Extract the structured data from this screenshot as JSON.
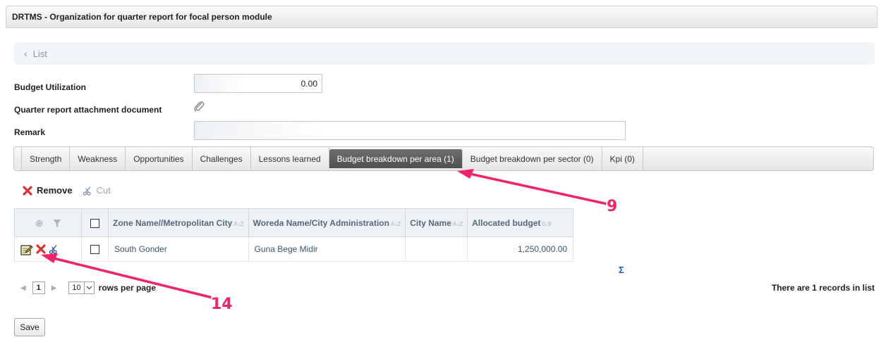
{
  "window": {
    "title": "DRTMS - Organization for quarter report for focal person module"
  },
  "nav": {
    "back_label": "List"
  },
  "form": {
    "budget_utilization_label": "Budget Utilization",
    "budget_utilization_value": "0.00",
    "attachment_label": "Quarter report attachment document",
    "remark_label": "Remark",
    "remark_value": ""
  },
  "tabs": [
    {
      "label": "Strength"
    },
    {
      "label": "Weakness"
    },
    {
      "label": "Opportunities"
    },
    {
      "label": "Challenges"
    },
    {
      "label": "Lessons learned"
    },
    {
      "label": "Budget breakdown per area (1)",
      "active": true
    },
    {
      "label": "Budget breakdown per sector (0)"
    },
    {
      "label": "Kpi (0)"
    }
  ],
  "toolbar": {
    "remove_label": "Remove",
    "cut_label": "Cut"
  },
  "grid": {
    "columns": [
      "Zone Name//Metropolitan City",
      "Woreda Name/City Administration",
      "City Name",
      "Allocated budget"
    ],
    "rows": [
      {
        "zone": "South Gonder",
        "woreda": "Guna Bege Midir",
        "city": "",
        "budget": "1,250,000.00"
      }
    ],
    "sigma": "Σ"
  },
  "pager": {
    "page": "1",
    "rows_per_page": "10",
    "rows_label": "rows per page",
    "records_text": "There are 1 records in list"
  },
  "actions": {
    "save_label": "Save"
  },
  "annotations": {
    "label_a": "9",
    "label_b": "14",
    "color": "#f2226d"
  },
  "colors": {
    "active_tab": "#5c5c5c",
    "link_blue": "#1a55c9",
    "remove_red": "#d9342b"
  }
}
